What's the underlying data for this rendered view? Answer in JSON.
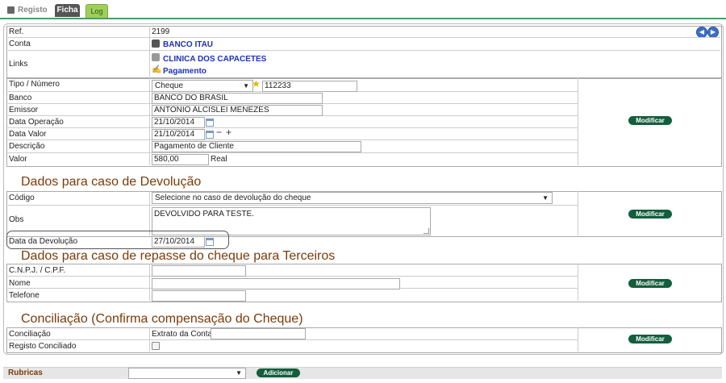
{
  "tabs": {
    "registo": "Registo",
    "ficha": "Ficha",
    "log": "Log"
  },
  "top": {
    "ref_label": "Ref.",
    "ref_value": "2199",
    "conta_label": "Conta",
    "conta_value": "BANCO ITAU",
    "links_label": "Links",
    "link1": "CLINICA DOS CAPACETES",
    "link2": "Pagamento"
  },
  "details": {
    "tipo_label": "Tipo / Número",
    "tipo_value": "Cheque",
    "numero_value": "112233",
    "banco_label": "Banco",
    "banco_value": "BANCO DO BRASIL",
    "emissor_label": "Emissor",
    "emissor_value": "ANTONIO ALCISLEI MENEZES",
    "data_operacao_label": "Data Operação",
    "data_operacao_value": "21/10/2014",
    "data_valor_label": "Data Valor",
    "data_valor_value": "21/10/2014",
    "descricao_label": "Descrição",
    "descricao_value": "Pagamento de Cliente",
    "valor_label": "Valor",
    "valor_value": "580,00",
    "valor_unit": "Real",
    "modify_label": "Modificar"
  },
  "devolucao": {
    "title": "Dados para caso de Devolução",
    "codigo_label": "Código",
    "codigo_value": "Selecione no caso de devolução do cheque",
    "obs_label": "Obs",
    "obs_value": "DEVOLVIDO PARA TESTE.",
    "data_label": "Data da Devolução",
    "data_value": "27/10/2014",
    "modify_label": "Modificar"
  },
  "repasse": {
    "title": "Dados para caso de repasse do cheque para Terceiros",
    "cnpj_label": "C.N.P.J. / C.P.F.",
    "cnpj_value": "",
    "nome_label": "Nome",
    "nome_value": "",
    "telefone_label": "Telefone",
    "telefone_value": "",
    "modify_label": "Modificar"
  },
  "conciliacao": {
    "title": "Conciliação (Confirma compensação do Cheque)",
    "conciliacao_label": "Conciliação",
    "extrato_label": "Extrato da Conta",
    "extrato_value": "",
    "registo_label": "Registo Conciliado",
    "modify_label": "Modificar"
  },
  "rubricas": {
    "label": "Rubricas",
    "select_value": "",
    "add_label": "Adicionar"
  },
  "colors": {
    "accent_green": "#135e3d",
    "section_brown": "#7a3b0a",
    "link_blue": "#1d32b4"
  }
}
